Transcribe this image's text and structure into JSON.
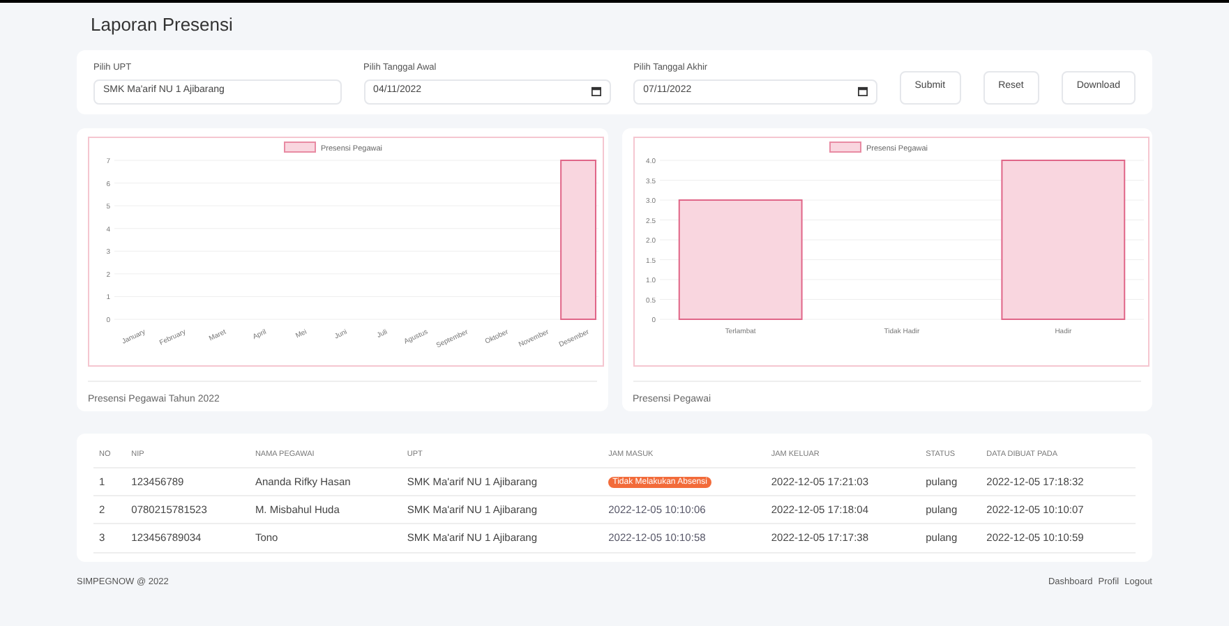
{
  "page_title": "Laporan Presensi",
  "filters": {
    "upt": {
      "label": "Pilih UPT",
      "value": "SMK Ma'arif NU 1 Ajibarang"
    },
    "start": {
      "label": "Pilih Tanggal Awal",
      "value": "04/11/2022"
    },
    "end": {
      "label": "Pilih Tanggal Akhir",
      "value": "07/11/2022"
    },
    "buttons": [
      "Submit",
      "Reset",
      "Download"
    ]
  },
  "charts": [
    {
      "caption": "Presensi Pegawai Tahun 2022",
      "chart_data": {
        "type": "bar",
        "categories": [
          "January",
          "February",
          "Maret",
          "April",
          "Mei",
          "Juni",
          "Juli",
          "Agustus",
          "September",
          "Oktober",
          "November",
          "Desember"
        ],
        "series": [
          {
            "name": "Presensi Pegawai",
            "color": "#f9d6df",
            "values": [
              0,
              0,
              0,
              0,
              0,
              0,
              0,
              0,
              0,
              0,
              0,
              7
            ]
          }
        ],
        "ylim": [
          0,
          7
        ],
        "grid": true,
        "yticks": [
          0,
          1,
          2,
          3,
          4,
          5,
          6,
          7
        ]
      }
    },
    {
      "caption": "Presensi Pegawai",
      "chart_data": {
        "type": "bar",
        "categories": [
          "Terlambat",
          "Tidak Hadir",
          "Hadir"
        ],
        "series": [
          {
            "name": "Presensi Pegawai",
            "color": "#f9d6df",
            "values": [
              3,
              0,
              4
            ]
          }
        ],
        "ylim": [
          0,
          4
        ],
        "grid": true,
        "yticks": [
          {
            "value": 0,
            "label": "0"
          },
          {
            "value": 0.5,
            "label": "0.5"
          },
          {
            "value": 1,
            "label": "1.0"
          },
          {
            "value": 1.5,
            "label": "1.5"
          },
          {
            "value": 2,
            "label": "2.0"
          },
          {
            "value": 2.5,
            "label": "2.5"
          },
          {
            "value": 3,
            "label": "3.0"
          },
          {
            "value": 3.5,
            "label": "3.5"
          },
          {
            "value": 4,
            "label": "4.0"
          }
        ]
      }
    }
  ],
  "table": {
    "columns": [
      "NO",
      "NIP",
      "NAMA PEGAWAI",
      "UPT",
      "JAM MASUK",
      "JAM KELUAR",
      "STATUS",
      "DATA DIBUAT PADA"
    ],
    "rows": [
      {
        "no": "1",
        "nip": "123456789",
        "name": "Ananda Rifky Hasan",
        "upt": "SMK Ma'arif NU 1 Ajibarang",
        "in": {
          "kind": "badge",
          "text": "Tidak Melakukan Absensi"
        },
        "out": "2022-12-05 17:21:03",
        "status": "pulang",
        "created": "2022-12-05 17:18:32"
      },
      {
        "no": "2",
        "nip": "0780215781523",
        "name": "M. Misbahul Huda",
        "upt": "SMK Ma'arif NU 1 Ajibarang",
        "in": {
          "kind": "time",
          "text": "2022-12-05 10:10:06"
        },
        "out": "2022-12-05 17:18:04",
        "status": "pulang",
        "created": "2022-12-05 10:10:07"
      },
      {
        "no": "3",
        "nip": "123456789034",
        "name": "Tono",
        "upt": "SMK Ma'arif NU 1 Ajibarang",
        "in": {
          "kind": "time",
          "text": "2022-12-05 10:10:58"
        },
        "out": "2022-12-05 17:17:38",
        "status": "pulang",
        "created": "2022-12-05 10:10:59"
      }
    ]
  },
  "footer": {
    "copyright": "SIMPEGNOW @ 2022",
    "links": [
      "Dashboard",
      "Profil",
      "Logout"
    ]
  }
}
